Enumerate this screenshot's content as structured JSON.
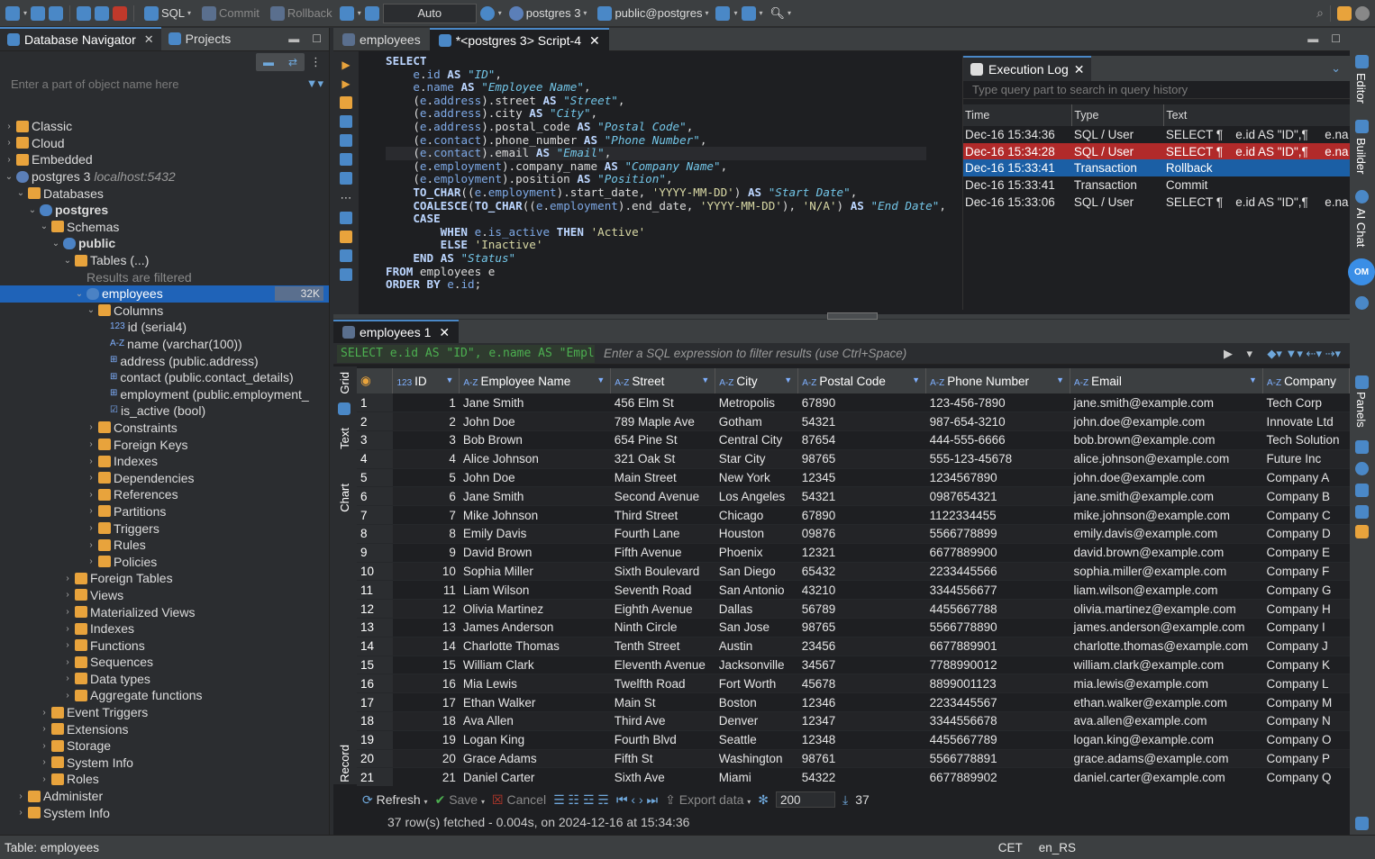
{
  "toolbar": {
    "sql": "SQL",
    "commit": "Commit",
    "rollback": "Rollback",
    "mode": "Auto",
    "connection": "postgres 3",
    "schema": "public@postgres"
  },
  "navigator": {
    "tab_db": "Database Navigator",
    "tab_projects": "Projects",
    "search_placeholder": "Enter a part of object name here",
    "tree": [
      {
        "label": "Classic",
        "level": 0,
        "arrow": "›",
        "icon": "folder"
      },
      {
        "label": "Cloud",
        "level": 0,
        "arrow": "›",
        "icon": "folder"
      },
      {
        "label": "Embedded",
        "level": 0,
        "arrow": "›",
        "icon": "folder"
      },
      {
        "label": "postgres 3",
        "host": "localhost:5432",
        "level": 0,
        "arrow": "⌄",
        "icon": "pg"
      },
      {
        "label": "Databases",
        "level": 1,
        "arrow": "⌄",
        "icon": "folder"
      },
      {
        "label": "postgres",
        "level": 2,
        "arrow": "⌄",
        "icon": "db",
        "bold": true
      },
      {
        "label": "Schemas",
        "level": 3,
        "arrow": "⌄",
        "icon": "folder"
      },
      {
        "label": "public",
        "level": 4,
        "arrow": "⌄",
        "icon": "db",
        "bold": true
      },
      {
        "label": "Tables (...)",
        "level": 5,
        "arrow": "⌄",
        "icon": "folder"
      },
      {
        "label": "Results are filtered",
        "level": 6,
        "arrow": "",
        "icon": "",
        "note": true
      },
      {
        "label": "employees",
        "level": 6,
        "arrow": "⌄",
        "icon": "db",
        "selected": true,
        "badge": "32K"
      },
      {
        "label": "Columns",
        "level": 7,
        "arrow": "⌄",
        "icon": "folder"
      },
      {
        "label": "id (serial4)",
        "level": 8,
        "arrow": "",
        "icon": "col",
        "type": "123"
      },
      {
        "label": "name (varchar(100))",
        "level": 8,
        "arrow": "",
        "icon": "col",
        "type": "A-Z"
      },
      {
        "label": "address (public.address)",
        "level": 8,
        "arrow": "",
        "icon": "col",
        "type": "⊞"
      },
      {
        "label": "contact (public.contact_details)",
        "level": 8,
        "arrow": "",
        "icon": "col",
        "type": "⊞"
      },
      {
        "label": "employment (public.employment_",
        "level": 8,
        "arrow": "",
        "icon": "col",
        "type": "⊞"
      },
      {
        "label": "is_active (bool)",
        "level": 8,
        "arrow": "",
        "icon": "col",
        "type": "☑"
      },
      {
        "label": "Constraints",
        "level": 7,
        "arrow": "›",
        "icon": "folder"
      },
      {
        "label": "Foreign Keys",
        "level": 7,
        "arrow": "›",
        "icon": "folder"
      },
      {
        "label": "Indexes",
        "level": 7,
        "arrow": "›",
        "icon": "folder"
      },
      {
        "label": "Dependencies",
        "level": 7,
        "arrow": "›",
        "icon": "folder"
      },
      {
        "label": "References",
        "level": 7,
        "arrow": "›",
        "icon": "folder"
      },
      {
        "label": "Partitions",
        "level": 7,
        "arrow": "›",
        "icon": "folder"
      },
      {
        "label": "Triggers",
        "level": 7,
        "arrow": "›",
        "icon": "folder"
      },
      {
        "label": "Rules",
        "level": 7,
        "arrow": "›",
        "icon": "folder"
      },
      {
        "label": "Policies",
        "level": 7,
        "arrow": "›",
        "icon": "folder"
      },
      {
        "label": "Foreign Tables",
        "level": 5,
        "arrow": "›",
        "icon": "folder"
      },
      {
        "label": "Views",
        "level": 5,
        "arrow": "›",
        "icon": "folder"
      },
      {
        "label": "Materialized Views",
        "level": 5,
        "arrow": "›",
        "icon": "folder"
      },
      {
        "label": "Indexes",
        "level": 5,
        "arrow": "›",
        "icon": "folder"
      },
      {
        "label": "Functions",
        "level": 5,
        "arrow": "›",
        "icon": "folder"
      },
      {
        "label": "Sequences",
        "level": 5,
        "arrow": "›",
        "icon": "folder"
      },
      {
        "label": "Data types",
        "level": 5,
        "arrow": "›",
        "icon": "folder"
      },
      {
        "label": "Aggregate functions",
        "level": 5,
        "arrow": "›",
        "icon": "folder"
      },
      {
        "label": "Event Triggers",
        "level": 3,
        "arrow": "›",
        "icon": "folder"
      },
      {
        "label": "Extensions",
        "level": 3,
        "arrow": "›",
        "icon": "folder"
      },
      {
        "label": "Storage",
        "level": 3,
        "arrow": "›",
        "icon": "folder"
      },
      {
        "label": "System Info",
        "level": 3,
        "arrow": "›",
        "icon": "folder"
      },
      {
        "label": "Roles",
        "level": 3,
        "arrow": "›",
        "icon": "folder"
      },
      {
        "label": "Administer",
        "level": 1,
        "arrow": "›",
        "icon": "folder"
      },
      {
        "label": "System Info",
        "level": 1,
        "arrow": "›",
        "icon": "folder"
      }
    ]
  },
  "editor": {
    "tab_employees": "employees",
    "tab_script": "*<postgres 3> Script-4",
    "code_lines": [
      "SELECT",
      "    e.id AS \"ID\",",
      "    e.name AS \"Employee Name\",",
      "    (e.address).street AS \"Street\",",
      "    (e.address).city AS \"City\",",
      "    (e.address).postal_code AS \"Postal Code\",",
      "    (e.contact).phone_number AS \"Phone Number\",",
      "    (e.contact).email AS \"Email\",",
      "    (e.employment).company_name AS \"Company Name\",",
      "    (e.employment).position AS \"Position\",",
      "    TO_CHAR((e.employment).start_date, 'YYYY-MM-DD') AS \"Start Date\",",
      "    COALESCE(TO_CHAR((e.employment).end_date, 'YYYY-MM-DD'), 'N/A') AS \"End Date\",",
      "    CASE",
      "        WHEN e.is_active THEN 'Active'",
      "        ELSE 'Inactive'",
      "    END AS \"Status\"",
      "FROM employees e",
      "ORDER BY e.id;"
    ]
  },
  "exec_log": {
    "title": "Execution Log",
    "search_placeholder": "Type query part to search in query history",
    "headers": [
      "Time",
      "Type",
      "Text",
      ""
    ],
    "rows": [
      {
        "time": "Dec-16 15:34:36",
        "type": "SQL / User",
        "text": "SELECT ¶",
        "extra": "e.id AS \"ID\",¶",
        "more": "e.na",
        "state": ""
      },
      {
        "time": "Dec-16 15:34:28",
        "type": "SQL / User",
        "text": "SELECT ¶",
        "extra": "e.id AS \"ID\",¶",
        "more": "e.na",
        "state": "err"
      },
      {
        "time": "Dec-16 15:33:41",
        "type": "Transaction",
        "text": "Rollback",
        "extra": "",
        "more": "",
        "state": "sel"
      },
      {
        "time": "Dec-16 15:33:41",
        "type": "Transaction",
        "text": "Commit",
        "extra": "",
        "more": "",
        "state": ""
      },
      {
        "time": "Dec-16 15:33:06",
        "type": "SQL / User",
        "text": "SELECT ¶",
        "extra": "e.id AS \"ID\",¶",
        "more": "e.na",
        "state": ""
      }
    ]
  },
  "rail": {
    "editor": "Editor",
    "builder": "Builder",
    "ai_chat": "AI Chat",
    "panels": "Panels",
    "om": "OM"
  },
  "results": {
    "tab": "employees 1",
    "filter_query": "SELECT e.id AS \"ID\", e.name AS \"Employ",
    "filter_placeholder": "Enter a SQL expression to filter results (use Ctrl+Space)",
    "side_grid": "Grid",
    "side_text": "Text",
    "side_chart": "Chart",
    "side_record": "Record",
    "columns": [
      {
        "name": "ID",
        "type": "123"
      },
      {
        "name": "Employee Name",
        "type": "A-Z"
      },
      {
        "name": "Street",
        "type": "A-Z"
      },
      {
        "name": "City",
        "type": "A-Z"
      },
      {
        "name": "Postal Code",
        "type": "A-Z"
      },
      {
        "name": "Phone Number",
        "type": "A-Z"
      },
      {
        "name": "Email",
        "type": "A-Z"
      },
      {
        "name": "Company",
        "type": "A-Z"
      }
    ],
    "rows": [
      [
        "1",
        "Jane Smith",
        "456 Elm St",
        "Metropolis",
        "67890",
        "123-456-7890",
        "jane.smith@example.com",
        "Tech Corp"
      ],
      [
        "2",
        "John Doe",
        "789 Maple Ave",
        "Gotham",
        "54321",
        "987-654-3210",
        "john.doe@example.com",
        "Innovate Ltd"
      ],
      [
        "3",
        "Bob Brown",
        "654 Pine St",
        "Central City",
        "87654",
        "444-555-6666",
        "bob.brown@example.com",
        "Tech Solution"
      ],
      [
        "4",
        "Alice Johnson",
        "321 Oak St",
        "Star City",
        "98765",
        "555-123-45678",
        "alice.johnson@example.com",
        "Future Inc"
      ],
      [
        "5",
        "John Doe",
        "Main Street",
        "New York",
        "12345",
        "1234567890",
        "john.doe@example.com",
        "Company A"
      ],
      [
        "6",
        "Jane Smith",
        "Second Avenue",
        "Los Angeles",
        "54321",
        "0987654321",
        "jane.smith@example.com",
        "Company B"
      ],
      [
        "7",
        "Mike Johnson",
        "Third Street",
        "Chicago",
        "67890",
        "1122334455",
        "mike.johnson@example.com",
        "Company C"
      ],
      [
        "8",
        "Emily Davis",
        "Fourth Lane",
        "Houston",
        "09876",
        "5566778899",
        "emily.davis@example.com",
        "Company D"
      ],
      [
        "9",
        "David Brown",
        "Fifth Avenue",
        "Phoenix",
        "12321",
        "6677889900",
        "david.brown@example.com",
        "Company E"
      ],
      [
        "10",
        "Sophia Miller",
        "Sixth Boulevard",
        "San Diego",
        "65432",
        "2233445566",
        "sophia.miller@example.com",
        "Company F"
      ],
      [
        "11",
        "Liam Wilson",
        "Seventh Road",
        "San Antonio",
        "43210",
        "3344556677",
        "liam.wilson@example.com",
        "Company G"
      ],
      [
        "12",
        "Olivia Martinez",
        "Eighth Avenue",
        "Dallas",
        "56789",
        "4455667788",
        "olivia.martinez@example.com",
        "Company H"
      ],
      [
        "13",
        "James Anderson",
        "Ninth Circle",
        "San Jose",
        "98765",
        "5566778890",
        "james.anderson@example.com",
        "Company I"
      ],
      [
        "14",
        "Charlotte Thomas",
        "Tenth Street",
        "Austin",
        "23456",
        "6677889901",
        "charlotte.thomas@example.com",
        "Company J"
      ],
      [
        "15",
        "William Clark",
        "Eleventh Avenue",
        "Jacksonville",
        "34567",
        "7788990012",
        "william.clark@example.com",
        "Company K"
      ],
      [
        "16",
        "Mia Lewis",
        "Twelfth Road",
        "Fort Worth",
        "45678",
        "8899001123",
        "mia.lewis@example.com",
        "Company L"
      ],
      [
        "17",
        "Ethan Walker",
        "Main St",
        "Boston",
        "12346",
        "2233445567",
        "ethan.walker@example.com",
        "Company M"
      ],
      [
        "18",
        "Ava Allen",
        "Third Ave",
        "Denver",
        "12347",
        "3344556678",
        "ava.allen@example.com",
        "Company N"
      ],
      [
        "19",
        "Logan King",
        "Fourth Blvd",
        "Seattle",
        "12348",
        "4455667789",
        "logan.king@example.com",
        "Company O"
      ],
      [
        "20",
        "Grace Adams",
        "Fifth St",
        "Washington",
        "98761",
        "5566778891",
        "grace.adams@example.com",
        "Company P"
      ],
      [
        "21",
        "Daniel Carter",
        "Sixth Ave",
        "Miami",
        "54322",
        "6677889902",
        "daniel.carter@example.com",
        "Company Q"
      ]
    ],
    "toolbar": {
      "refresh": "Refresh",
      "save": "Save",
      "cancel": "Cancel",
      "export": "Export data",
      "fetch_size": "200",
      "count": "37"
    },
    "status": "37 row(s) fetched - 0.004s, on 2024-12-16 at 15:34:36"
  },
  "statusbar": {
    "left": "Table: employees",
    "tz": "CET",
    "locale": "en_RS"
  }
}
